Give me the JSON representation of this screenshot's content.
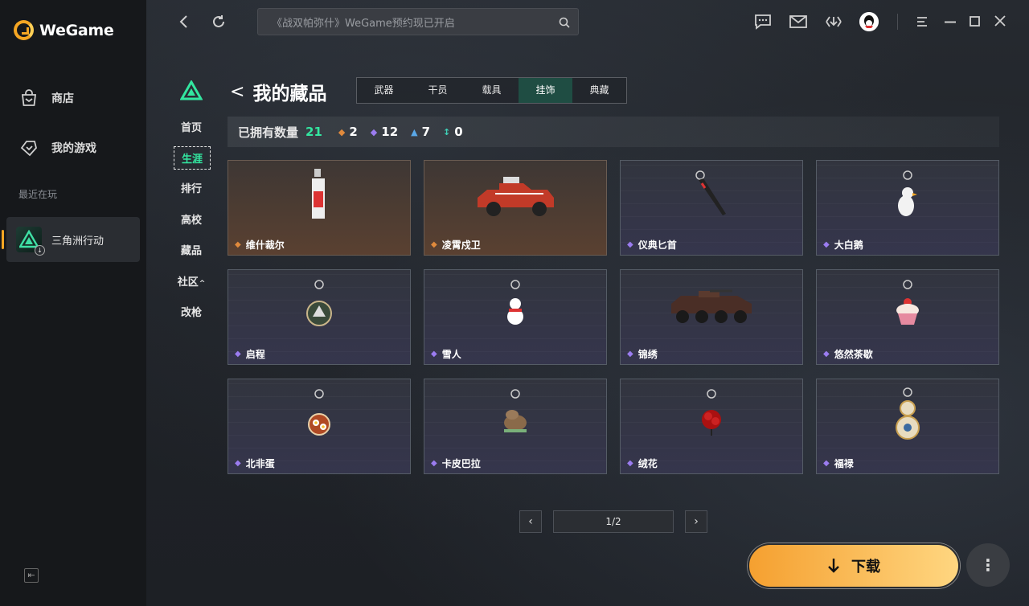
{
  "app": {
    "name": "WeGame"
  },
  "sidebar": {
    "items": [
      {
        "label": "商店",
        "icon": "shop-bag-icon"
      },
      {
        "label": "我的游戏",
        "icon": "gamepad-icon"
      }
    ],
    "recent_label": "最近在玩",
    "recent_game": {
      "name": "三角洲行动",
      "icon": "delta-force-icon"
    }
  },
  "topbar": {
    "search_placeholder": "《战双帕弥什》WeGame预约现已开启"
  },
  "game_nav": {
    "items": [
      "首页",
      "生涯",
      "排行",
      "高校",
      "藏品",
      "社区",
      "改枪"
    ],
    "active": "生涯"
  },
  "collection": {
    "back_title": "我的藏品",
    "tabs": [
      "武器",
      "干员",
      "载具",
      "挂饰",
      "典藏"
    ],
    "active_tab": "挂饰",
    "stats": {
      "label": "已拥有数量",
      "total": "21",
      "orange": "2",
      "purple": "12",
      "blue": "7",
      "teal": "0"
    },
    "items": [
      {
        "name": "维什裁尔",
        "rarity": "orange"
      },
      {
        "name": "凌霄戍卫",
        "rarity": "orange"
      },
      {
        "name": "仪典匕首",
        "rarity": "purple"
      },
      {
        "name": "大白鹅",
        "rarity": "purple"
      },
      {
        "name": "启程",
        "rarity": "purple"
      },
      {
        "name": "雪人",
        "rarity": "purple"
      },
      {
        "name": "锦绣",
        "rarity": "purple"
      },
      {
        "name": "悠然茶歇",
        "rarity": "purple"
      },
      {
        "name": "北非蛋",
        "rarity": "purple"
      },
      {
        "name": "卡皮巴拉",
        "rarity": "purple"
      },
      {
        "name": "绒花",
        "rarity": "purple"
      },
      {
        "name": "福禄",
        "rarity": "purple"
      }
    ]
  },
  "pager": {
    "text": "1/2"
  },
  "download": {
    "label": "下载"
  },
  "colors": {
    "accent": "#33e6a0",
    "brand": "#f5a623",
    "orange_gem": "#e08a3c",
    "purple_gem": "#9b7cf0"
  }
}
